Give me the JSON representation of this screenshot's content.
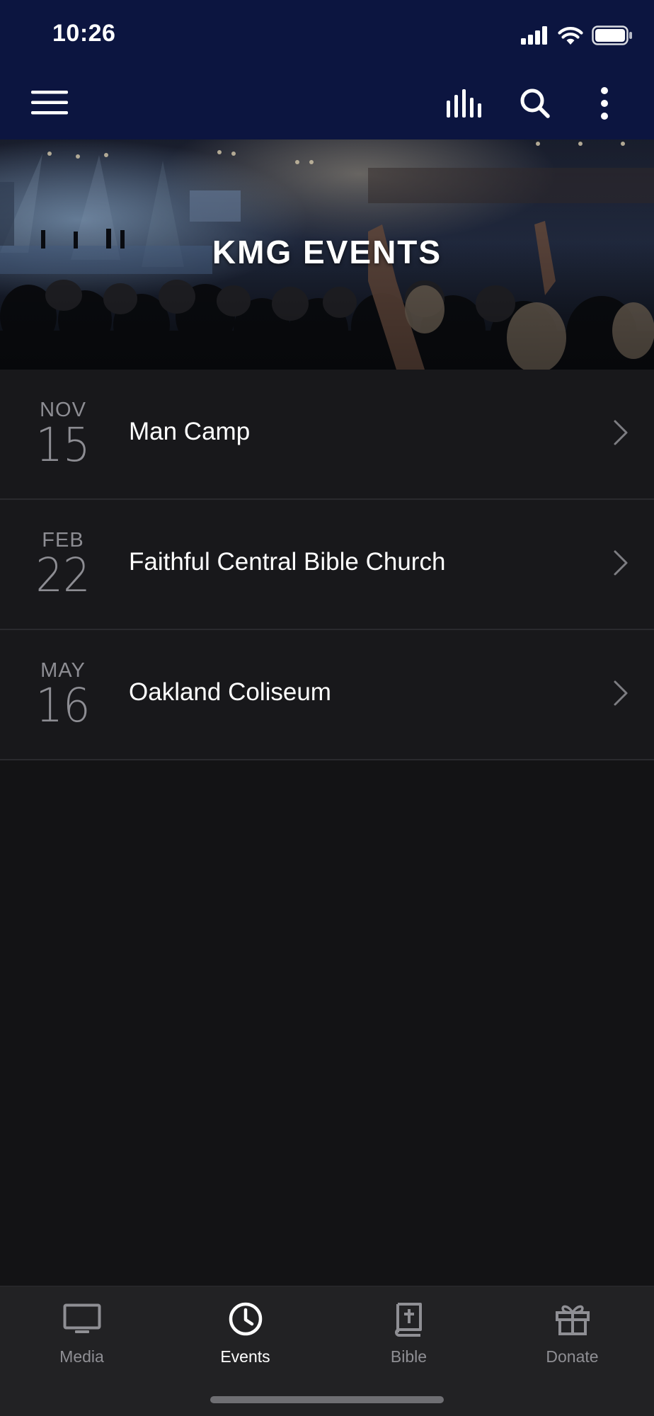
{
  "status_bar": {
    "time": "10:26",
    "icons": [
      "signal-icon",
      "wifi-icon",
      "battery-icon"
    ]
  },
  "toolbar": {
    "menu_icon": "hamburger-menu-icon",
    "actions": [
      "audio-bars-icon",
      "search-icon",
      "more-vertical-icon"
    ]
  },
  "hero": {
    "title": "KMG EVENTS"
  },
  "events": [
    {
      "month": "NOV",
      "day": "15",
      "name": "Man Camp"
    },
    {
      "month": "FEB",
      "day": "22",
      "name": "Faithful Central Bible Church"
    },
    {
      "month": "MAY",
      "day": "16",
      "name": "Oakland Coliseum"
    }
  ],
  "tabs": [
    {
      "label": "Media",
      "icon": "monitor-icon",
      "active": false
    },
    {
      "label": "Events",
      "icon": "clock-icon",
      "active": true
    },
    {
      "label": "Bible",
      "icon": "bible-icon",
      "active": false
    },
    {
      "label": "Donate",
      "icon": "gift-icon",
      "active": false
    }
  ],
  "colors": {
    "header_background": "#0c1540",
    "page_background": "#131315",
    "row_background": "#18181b",
    "tabbar_background": "#222224",
    "muted_text": "#8d8d93",
    "active_tab": "#ffffff"
  }
}
